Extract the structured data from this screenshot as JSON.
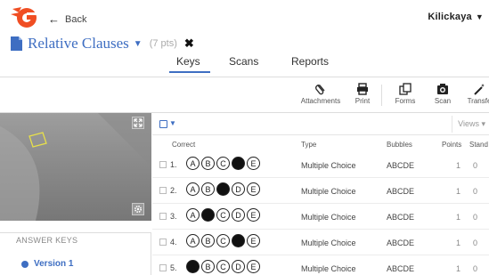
{
  "header": {
    "back_label": "Back",
    "user_name": "Kilickaya",
    "logo_colors": {
      "primary": "#f04e23",
      "secondary": "#f7941d"
    }
  },
  "quiz": {
    "title": "Relative Clauses",
    "points": "(7 pts)"
  },
  "tabs": [
    {
      "label": "Keys",
      "active": true
    },
    {
      "label": "Scans",
      "active": false
    },
    {
      "label": "Reports",
      "active": false
    }
  ],
  "toolbar": {
    "attachments": "Attachments",
    "print": "Print",
    "forms": "Forms",
    "scan": "Scan",
    "transfer": "Transfe"
  },
  "sidebar": {
    "section_title": "ANSWER KEYS",
    "versions": [
      {
        "label": "Version 1"
      }
    ]
  },
  "table": {
    "views_label": "Views ▾",
    "columns": {
      "correct": "Correct",
      "type": "Type",
      "bubbles": "Bubbles",
      "points": "Points",
      "standards": "Stand"
    },
    "rows": [
      {
        "num": "1.",
        "correct_index": 3,
        "type": "Multiple Choice",
        "bubbles": "ABCDE",
        "points": "1",
        "standard": "0"
      },
      {
        "num": "2.",
        "correct_index": 2,
        "type": "Multiple Choice",
        "bubbles": "ABCDE",
        "points": "1",
        "standard": "0"
      },
      {
        "num": "3.",
        "correct_index": 1,
        "type": "Multiple Choice",
        "bubbles": "ABCDE",
        "points": "1",
        "standard": "0"
      },
      {
        "num": "4.",
        "correct_index": 3,
        "type": "Multiple Choice",
        "bubbles": "ABCDE",
        "points": "1",
        "standard": "0"
      },
      {
        "num": "5.",
        "correct_index": 0,
        "type": "Multiple Choice",
        "bubbles": "ABCDE",
        "points": "1",
        "standard": "0"
      }
    ],
    "letters": [
      "A",
      "B",
      "C",
      "D",
      "E"
    ]
  },
  "colors": {
    "accent": "#3e6ec2"
  }
}
